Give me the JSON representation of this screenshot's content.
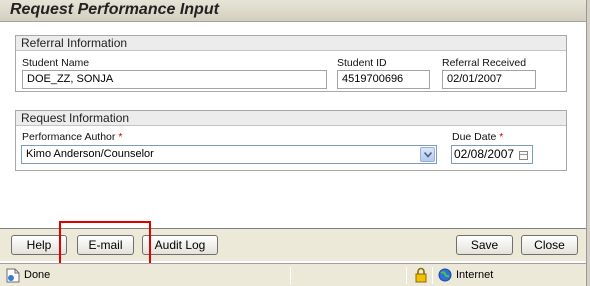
{
  "window": {
    "title": "Request Performance Input"
  },
  "referral": {
    "heading": "Referral Information",
    "student_name_label": "Student Name",
    "student_name_value": "DOE_ZZ, SONJA",
    "student_id_label": "Student ID",
    "student_id_value": "4519700696",
    "referral_received_label": "Referral Received",
    "referral_received_value": "02/01/2007"
  },
  "request": {
    "heading": "Request Information",
    "author_label": "Performance Author",
    "author_value": "Kimo Anderson/Counselor",
    "due_date_label": "Due Date",
    "due_date_value": "02/08/2007",
    "required_marker": "*"
  },
  "buttons": {
    "help": "Help",
    "email": "E-mail",
    "audit_log": "Audit Log",
    "save": "Save",
    "close": "Close"
  },
  "status": {
    "left_text": "Done",
    "zone_text": "Internet"
  },
  "colors": {
    "highlight": "#e00000",
    "required": "#cc0000"
  },
  "icons": [
    "page-icon",
    "lock-icon",
    "internet-globe-icon",
    "calendar-icon",
    "chevron-down-icon"
  ]
}
